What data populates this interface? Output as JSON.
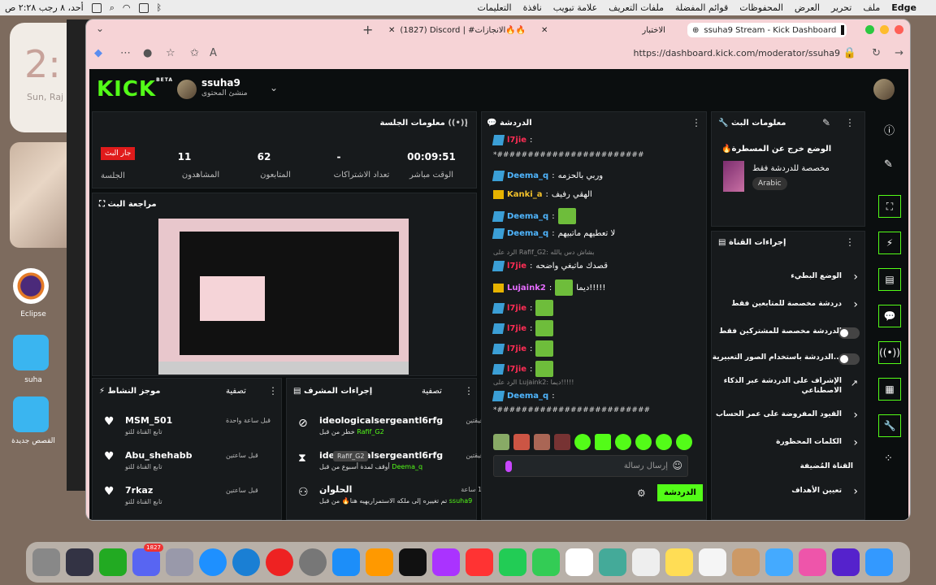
{
  "menubar": {
    "app": "Edge",
    "items": [
      "ملف",
      "تحرير",
      "العرض",
      "المحفوظات",
      "قوائم المفضلة",
      "ملفات التعريف",
      "علامة تبويب",
      "نافذة",
      "التعليمات"
    ],
    "datetime": "أحد، ٨ رجب ٢:٢٨ ص"
  },
  "desktop": {
    "clock": "2:",
    "date": "Sun, Raj",
    "icons": [
      "Eclipse",
      "suha",
      "القصص جديدة"
    ]
  },
  "browser": {
    "tabs": [
      {
        "title": "ssuha9 Stream - Kick Dashboard",
        "active": true
      },
      {
        "title": "الاختبار",
        "active": false
      },
      {
        "title": "(1827) Discord | #الانجازات🔥🔥",
        "active": false
      }
    ],
    "url": "https://dashboard.kick.com/moderator/ssuha9"
  },
  "header": {
    "logo": "KICK",
    "logo_badge": "BETA",
    "username": "ssuha9",
    "role": "منشئ المحتوى"
  },
  "session": {
    "title": "معلومات الجلسة",
    "live_badge": "جار البث",
    "live_label": "الجلسة",
    "stats": [
      {
        "value": "11",
        "label": "المشاهدون"
      },
      {
        "value": "62",
        "label": "المتابعون"
      },
      {
        "value": "-",
        "label": "تعداد الاشتراكات"
      },
      {
        "value": "00:09:51",
        "label": "الوقت مباشر"
      }
    ]
  },
  "preview": {
    "title": "مراجعة البث"
  },
  "activity": {
    "title": "موجز النشاط",
    "filter": "تصفية",
    "items": [
      {
        "name": "MSM_501",
        "sub": "تابع القناة للتو",
        "time": "قبل ساعة واحدة"
      },
      {
        "name": "Abu_shehabb",
        "sub": "تابع القناة للتو",
        "time": "قبل ساعتين"
      },
      {
        "name": "7rkaz",
        "sub": "تابع القناة للتو",
        "time": "قبل ساعتين"
      }
    ]
  },
  "mod_actions": {
    "title": "إجراءات المشرف",
    "filter": "تصفية",
    "items": [
      {
        "icon": "ban-icon",
        "name": "ideologicalsergeantl6rfg",
        "sub": "خطر من قبل",
        "by": "Rafif_G2",
        "time": "قبل دقيقتين"
      },
      {
        "icon": "hourglass-icon",
        "name": "ideologicalsergeantl6rfg",
        "sub": "أوقف لمدة أسبوع من قبل",
        "by": "Deema_q",
        "time": "قبل دقيقتين"
      },
      {
        "icon": "users-icon",
        "name": "الحلوان",
        "sub": "تم تغييره إلى ملكه الاستمراريهيه هنا🔥 من قبل",
        "by": "ssuha9",
        "time": "قبل 12 ساعة"
      }
    ],
    "tooltip": "Rafif_G2"
  },
  "chat": {
    "title": "الدردشة",
    "messages": [
      {
        "badge": "mod",
        "user": "l7jie",
        "color": "red",
        "text": "",
        "emote": false
      },
      {
        "badge": "",
        "user": "",
        "color": "",
        "text": "*########################",
        "emote": false
      },
      {
        "badge": "mod",
        "user": "Deema_q",
        "color": "blue",
        "text": "وربي بالحزمه",
        "emote": false
      },
      {
        "badge": "crown",
        "user": "Kanki_a",
        "color": "yellow",
        "text": "الهقي رفيف",
        "emote": false
      },
      {
        "badge": "mod",
        "user": "Deema_q",
        "color": "blue",
        "text": "",
        "emote": true
      },
      {
        "badge": "mod",
        "user": "Deema_q",
        "color": "blue",
        "text": "لا تعطيهم ماتبيهم",
        "emote": false
      },
      {
        "badge": "",
        "user": "",
        "color": "",
        "text": "الرد على Rafif_G2: بشاش دس يالله",
        "emote": false,
        "reply": true
      },
      {
        "badge": "mod",
        "user": "l7jie",
        "color": "red",
        "text": "قصدك ماتبغي واضحه",
        "emote": false
      },
      {
        "badge": "crown",
        "user": "Lujaink2",
        "color": "pink",
        "text": "ديما!!!!!",
        "emote": true
      },
      {
        "badge": "mod",
        "user": "l7jie",
        "color": "red",
        "text": "",
        "emote": true
      },
      {
        "badge": "mod",
        "user": "l7jie",
        "color": "red",
        "text": "",
        "emote": true
      },
      {
        "badge": "mod",
        "user": "l7jie",
        "color": "red",
        "text": "",
        "emote": true
      },
      {
        "badge": "mod",
        "user": "l7jie",
        "color": "red",
        "text": "",
        "emote": true
      },
      {
        "badge": "",
        "user": "",
        "color": "",
        "text": "الرد على Lujaink2: ديما!!!!!",
        "emote": false,
        "reply": true
      },
      {
        "badge": "mod",
        "user": "Deema_q",
        "color": "blue",
        "text": "",
        "emote": false
      },
      {
        "badge": "",
        "user": "",
        "color": "",
        "text": "*#########################",
        "emote": false
      }
    ],
    "input_placeholder": "إرسال رسالة",
    "send_button": "الدردشة"
  },
  "stream_info": {
    "title": "معلومات البث",
    "stream_title": "الوضع خرج عن المسطرة🔥",
    "category": "مخصصة للدردشة فقط",
    "language": "Arabic"
  },
  "channel_actions": {
    "title": "إجراءات القناة",
    "items": [
      {
        "label": "الوضع البطيء",
        "control": "arrow"
      },
      {
        "label": "دردشة مخصصة للمتابعين فقط",
        "control": "arrow"
      },
      {
        "label": "الدردشة مخصصة للمشتركين فقط",
        "control": "toggle"
      },
      {
        "label": "الدردشة باستخدام الصور التعبيرية...",
        "control": "toggle"
      },
      {
        "label": "الإشراف على الدردشة عبر الذكاء الاصطناعي",
        "control": "external"
      },
      {
        "label": "القيود المفروضة على عمر الحساب",
        "control": "arrow"
      },
      {
        "label": "الكلمات المحظورة",
        "control": "arrow"
      },
      {
        "label": "القناة المُضيفة",
        "control": "none"
      },
      {
        "label": "تعيين الأهداف",
        "control": "arrow"
      }
    ]
  },
  "dock": {
    "discord_badge": "1827"
  },
  "colors": {
    "kick_green": "#53fc18",
    "live_red": "#e01b1b",
    "panel_bg": "#171a1c"
  }
}
